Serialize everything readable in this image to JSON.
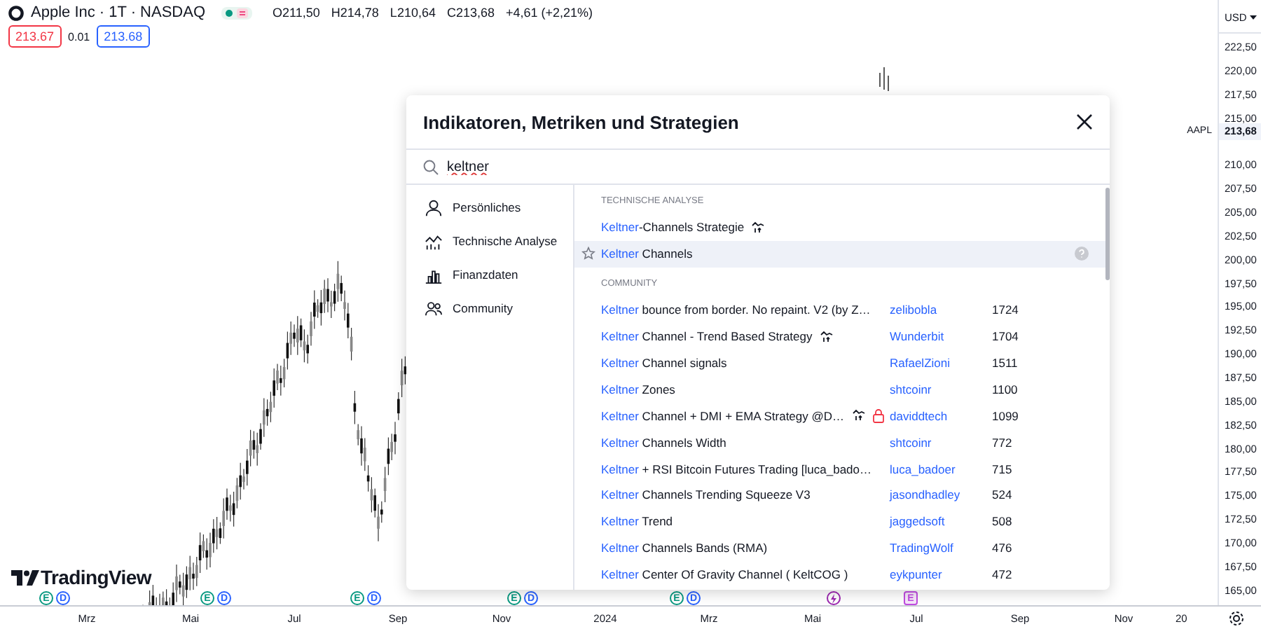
{
  "header": {
    "symbol": "Apple Inc · 1T · NASDAQ",
    "ohlc": [
      {
        "label": "O",
        "value": "211,50"
      },
      {
        "label": "H",
        "value": "214,78"
      },
      {
        "label": "L",
        "value": "210,64"
      },
      {
        "label": "C",
        "value": "213,68"
      }
    ],
    "change": "+4,61 (+2,21%)",
    "sell": "213.67",
    "spread": "0.01",
    "buy": "213.68"
  },
  "price_axis": {
    "currency": "USD",
    "labels": [
      {
        "kind": "tick",
        "text": "222,50"
      },
      {
        "kind": "tick",
        "text": "220,00"
      },
      {
        "kind": "tick",
        "text": "217,50"
      },
      {
        "kind": "tick",
        "text": "215,00"
      },
      {
        "kind": "current",
        "text": "213,68",
        "symbol": "AAPL"
      },
      {
        "kind": "tick",
        "text": "210,00"
      },
      {
        "kind": "tick",
        "text": "207,50"
      },
      {
        "kind": "tick",
        "text": "205,00"
      },
      {
        "kind": "tick",
        "text": "202,50"
      },
      {
        "kind": "tick",
        "text": "200,00"
      },
      {
        "kind": "tick",
        "text": "197,50"
      },
      {
        "kind": "tick",
        "text": "195,00"
      },
      {
        "kind": "tick",
        "text": "192,50"
      },
      {
        "kind": "tick",
        "text": "190,00"
      },
      {
        "kind": "tick",
        "text": "187,50"
      },
      {
        "kind": "tick",
        "text": "185,00"
      },
      {
        "kind": "tick",
        "text": "182,50"
      },
      {
        "kind": "tick",
        "text": "180,00"
      },
      {
        "kind": "tick",
        "text": "177,50"
      },
      {
        "kind": "tick",
        "text": "175,00"
      },
      {
        "kind": "tick",
        "text": "172,50"
      },
      {
        "kind": "tick",
        "text": "170,00"
      },
      {
        "kind": "tick",
        "text": "167,50"
      },
      {
        "kind": "tick",
        "text": "165,00"
      }
    ]
  },
  "time_axis": [
    "Mrz",
    "Mai",
    "Jul",
    "Sep",
    "Nov",
    "2024",
    "Mrz",
    "Mai",
    "Jul",
    "Sep",
    "Nov",
    "20"
  ],
  "events": [
    {
      "items": [
        {
          "kind": "earnings",
          "letter": "E"
        },
        {
          "kind": "dividend",
          "letter": "D"
        }
      ]
    },
    {
      "items": [
        {
          "kind": "earnings",
          "letter": "E"
        },
        {
          "kind": "dividend",
          "letter": "D"
        }
      ]
    },
    {
      "items": [
        {
          "kind": "earnings",
          "letter": "E"
        },
        {
          "kind": "dividend",
          "letter": "D"
        }
      ]
    },
    {
      "items": [
        {
          "kind": "earnings",
          "letter": "E"
        },
        {
          "kind": "dividend",
          "letter": "D"
        }
      ]
    },
    {
      "items": [
        {
          "kind": "earnings",
          "letter": "E"
        },
        {
          "kind": "dividend",
          "letter": "D"
        }
      ]
    },
    {
      "items": [
        {
          "kind": "split"
        }
      ]
    },
    {
      "items": [
        {
          "kind": "upcoming",
          "letter": "E"
        }
      ]
    }
  ],
  "logo": "TradingView",
  "dialog": {
    "title": "Indikatoren, Metriken und Strategien",
    "search": {
      "value": "keltner"
    },
    "sidebar": [
      {
        "kind": "personal",
        "label": "Persönliches"
      },
      {
        "kind": "technical",
        "label": "Technische Analyse"
      },
      {
        "kind": "financial",
        "label": "Finanzdaten"
      },
      {
        "kind": "community",
        "label": "Community"
      }
    ],
    "sections": [
      {
        "title": "TECHNISCHE ANALYSE",
        "rows": [
          {
            "match": "Keltner",
            "rest": "-Channels Strategie",
            "strategy": true,
            "locked": false,
            "highlighted": false
          },
          {
            "match": "Keltner",
            "rest": " Channels",
            "strategy": false,
            "locked": false,
            "highlighted": true
          }
        ]
      },
      {
        "title": "COMMUNITY",
        "rows": [
          {
            "match": "Keltner",
            "rest": " bounce from border. No repaint. V2 (by Z…",
            "author": "zelibobla",
            "count": "1724",
            "strategy": false,
            "locked": false,
            "highlighted": false
          },
          {
            "match": "Keltner",
            "rest": " Channel - Trend Based Strategy",
            "author": "Wunderbit",
            "count": "1704",
            "strategy": true,
            "locked": false,
            "highlighted": false
          },
          {
            "match": "Keltner",
            "rest": " Channel signals",
            "author": "RafaelZioni",
            "count": "1511",
            "strategy": false,
            "locked": false,
            "highlighted": false
          },
          {
            "match": "Keltner",
            "rest": " Zones",
            "author": "shtcoinr",
            "count": "1100",
            "strategy": false,
            "locked": false,
            "highlighted": false
          },
          {
            "match": "Keltner",
            "rest": " Channel + DMI + EMA Strategy @D…",
            "author": "daviddtech",
            "count": "1099",
            "strategy": true,
            "locked": true,
            "highlighted": false
          },
          {
            "match": "Keltner",
            "rest": " Channels Width",
            "author": "shtcoinr",
            "count": "772",
            "strategy": false,
            "locked": false,
            "highlighted": false
          },
          {
            "match": "Keltner",
            "rest": " + RSI Bitcoin Futures Trading [luca_bado…",
            "author": "luca_badoer",
            "count": "715",
            "strategy": false,
            "locked": false,
            "highlighted": false
          },
          {
            "match": "Keltner",
            "rest": " Channels Trending Squeeze V3",
            "author": "jasondhadley",
            "count": "524",
            "strategy": false,
            "locked": false,
            "highlighted": false
          },
          {
            "match": "Keltner",
            "rest": " Trend",
            "author": "jaggedsoft",
            "count": "508",
            "strategy": false,
            "locked": false,
            "highlighted": false
          },
          {
            "match": "Keltner",
            "rest": " Channels Bands (RMA)",
            "author": "TradingWolf",
            "count": "476",
            "strategy": false,
            "locked": false,
            "highlighted": false
          },
          {
            "match": "Keltner",
            "rest": " Center Of Gravity Channel ( KeltCOG )",
            "author": "eykpunter",
            "count": "472",
            "strategy": false,
            "locked": false,
            "highlighted": false
          }
        ]
      }
    ]
  }
}
